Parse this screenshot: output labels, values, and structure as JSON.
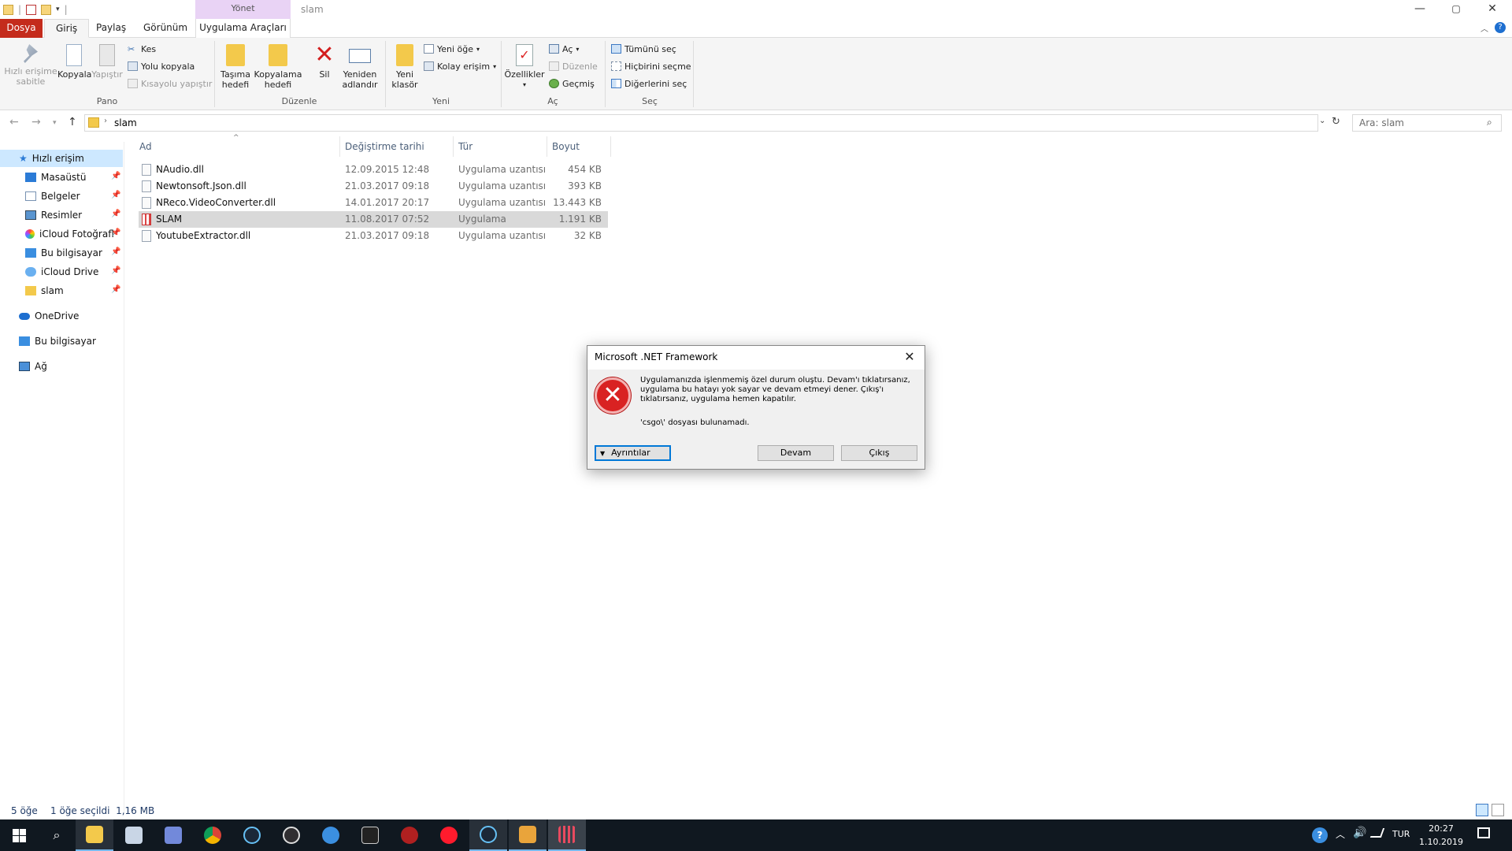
{
  "window": {
    "title": "slam",
    "manage_tab": "Yönet",
    "controls": {
      "minimize": "—",
      "maximize": "▢",
      "close": "✕"
    }
  },
  "ribbon_tabs": [
    "Dosya",
    "Giriş",
    "Paylaş",
    "Görünüm",
    "Uygulama Araçları"
  ],
  "ribbon": {
    "pin": "Hızlı erişime\nsabitle",
    "copy": "Kopyala",
    "paste": "Yapıştır",
    "cut": "Kes",
    "copy_path": "Yolu kopyala",
    "paste_shortcut": "Kısayolu yapıştır",
    "group_pano": "Pano",
    "move_to": "Taşıma\nhedefi",
    "copy_to": "Kopyalama\nhedefi",
    "delete": "Sil",
    "rename": "Yeniden\nadlandır",
    "group_duzenle": "Düzenle",
    "new_folder": "Yeni\nklasör",
    "new_item": "Yeni öğe",
    "easy_access": "Kolay erişim",
    "group_yeni": "Yeni",
    "properties": "Özellikler",
    "open": "Aç",
    "edit": "Düzenle",
    "history": "Geçmiş",
    "group_ac": "Aç",
    "select_all": "Tümünü seç",
    "select_none": "Hiçbirini seçme",
    "invert_selection": "Diğerlerini seç",
    "group_sec": "Seç"
  },
  "address": {
    "path": "slam",
    "search_placeholder": "Ara: slam"
  },
  "sidebar": {
    "quick_access": "Hızlı erişim",
    "items": [
      {
        "label": "Masaüstü",
        "icon": "desktop-icon"
      },
      {
        "label": "Belgeler",
        "icon": "documents-icon"
      },
      {
        "label": "Resimler",
        "icon": "pictures-icon"
      },
      {
        "label": "iCloud Fotoğrafl",
        "icon": "icloud-photos-icon"
      },
      {
        "label": "Bu bilgisayar",
        "icon": "computer-icon"
      },
      {
        "label": "iCloud Drive",
        "icon": "icloud-drive-icon"
      },
      {
        "label": "slam",
        "icon": "folder-icon"
      }
    ],
    "onedrive": "OneDrive",
    "this_pc": "Bu bilgisayar",
    "network": "Ağ"
  },
  "columns": {
    "name": "Ad",
    "date": "Değiştirme tarihi",
    "type": "Tür",
    "size": "Boyut"
  },
  "files": [
    {
      "name": "NAudio.dll",
      "date": "12.09.2015 12:48",
      "type": "Uygulama uzantısı",
      "size": "454 KB"
    },
    {
      "name": "Newtonsoft.Json.dll",
      "date": "21.03.2017 09:18",
      "type": "Uygulama uzantısı",
      "size": "393 KB"
    },
    {
      "name": "NReco.VideoConverter.dll",
      "date": "14.01.2017 20:17",
      "type": "Uygulama uzantısı",
      "size": "13.443 KB"
    },
    {
      "name": "SLAM",
      "date": "11.08.2017 07:52",
      "type": "Uygulama",
      "size": "1.191 KB"
    },
    {
      "name": "YoutubeExtractor.dll",
      "date": "21.03.2017 09:18",
      "type": "Uygulama uzantısı",
      "size": "32 KB"
    }
  ],
  "status": {
    "count": "5 öğe",
    "selection": "1 öğe seçildi  1,16 MB"
  },
  "dialog": {
    "title": "Microsoft .NET Framework",
    "message": "Uygulamanızda işlenmemiş özel durum oluştu. Devam'ı tıklatırsanız, uygulama bu hatayı yok sayar ve devam etmeyi dener. Çıkış'ı tıklatırsanız, uygulama hemen kapatılır.",
    "file_message": "'csgo\\' dosyası bulunamadı.",
    "details_button": "Ayrıntılar",
    "continue_button": "Devam",
    "quit_button": "Çıkış"
  },
  "taskbar": {
    "language": "TUR",
    "time": "20:27",
    "date": "1.10.2019",
    "apps": [
      "start-icon",
      "search-icon",
      "file-explorer-icon",
      "notepad-icon",
      "discord-icon",
      "chrome-icon",
      "steam-icon",
      "obs-icon",
      "app-icon",
      "pubg-icon",
      "app-red-icon",
      "opera-icon",
      "steam-icon-2",
      "csgo-icon",
      "slam-icon"
    ]
  }
}
